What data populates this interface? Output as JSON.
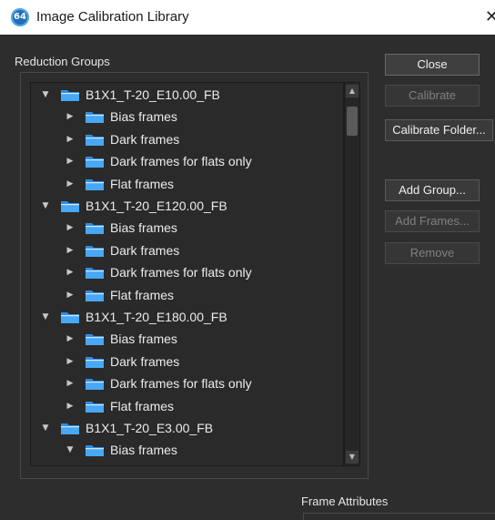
{
  "window": {
    "title": "Image Calibration Library",
    "icon_text": "64",
    "close_glyph": "✕"
  },
  "reduction_groups": {
    "label": "Reduction Groups",
    "rows": [
      {
        "label": "B1X1_T-20_E10.00_FB",
        "level": 0,
        "expanded": true,
        "icon": "folder-icon"
      },
      {
        "label": "Bias frames",
        "level": 1,
        "expanded": false,
        "icon": "folder-icon"
      },
      {
        "label": "Dark frames",
        "level": 1,
        "expanded": false,
        "icon": "folder-icon"
      },
      {
        "label": "Dark frames for flats only",
        "level": 1,
        "expanded": false,
        "icon": "folder-icon"
      },
      {
        "label": "Flat frames",
        "level": 1,
        "expanded": false,
        "icon": "folder-icon"
      },
      {
        "label": "B1X1_T-20_E120.00_FB",
        "level": 0,
        "expanded": true,
        "icon": "folder-icon"
      },
      {
        "label": "Bias frames",
        "level": 1,
        "expanded": false,
        "icon": "folder-icon"
      },
      {
        "label": "Dark frames",
        "level": 1,
        "expanded": false,
        "icon": "folder-icon"
      },
      {
        "label": "Dark frames for flats only",
        "level": 1,
        "expanded": false,
        "icon": "folder-icon"
      },
      {
        "label": "Flat frames",
        "level": 1,
        "expanded": false,
        "icon": "folder-icon"
      },
      {
        "label": "B1X1_T-20_E180.00_FB",
        "level": 0,
        "expanded": true,
        "icon": "folder-icon"
      },
      {
        "label": "Bias frames",
        "level": 1,
        "expanded": false,
        "icon": "folder-icon"
      },
      {
        "label": "Dark frames",
        "level": 1,
        "expanded": false,
        "icon": "folder-icon"
      },
      {
        "label": "Dark frames for flats only",
        "level": 1,
        "expanded": false,
        "icon": "folder-icon"
      },
      {
        "label": "Flat frames",
        "level": 1,
        "expanded": false,
        "icon": "folder-icon"
      },
      {
        "label": "B1X1_T-20_E3.00_FB",
        "level": 0,
        "expanded": true,
        "icon": "folder-icon"
      },
      {
        "label": "Bias frames",
        "level": 1,
        "expanded": true,
        "icon": "folder-icon"
      }
    ]
  },
  "buttons": {
    "close": {
      "label": "Close",
      "enabled": true
    },
    "calibrate": {
      "label": "Calibrate",
      "enabled": false
    },
    "calibrate_folder": {
      "label": "Calibrate Folder...",
      "enabled": true
    },
    "add_group": {
      "label": "Add Group...",
      "enabled": true
    },
    "add_frames": {
      "label": "Add Frames...",
      "enabled": false
    },
    "remove": {
      "label": "Remove",
      "enabled": false
    }
  },
  "frame_attributes": {
    "label": "Frame Attributes"
  },
  "colors": {
    "background": "#2d2d2d",
    "folder_blue": "#2f8de4",
    "text": "#ececec",
    "disabled_text": "#808080"
  }
}
